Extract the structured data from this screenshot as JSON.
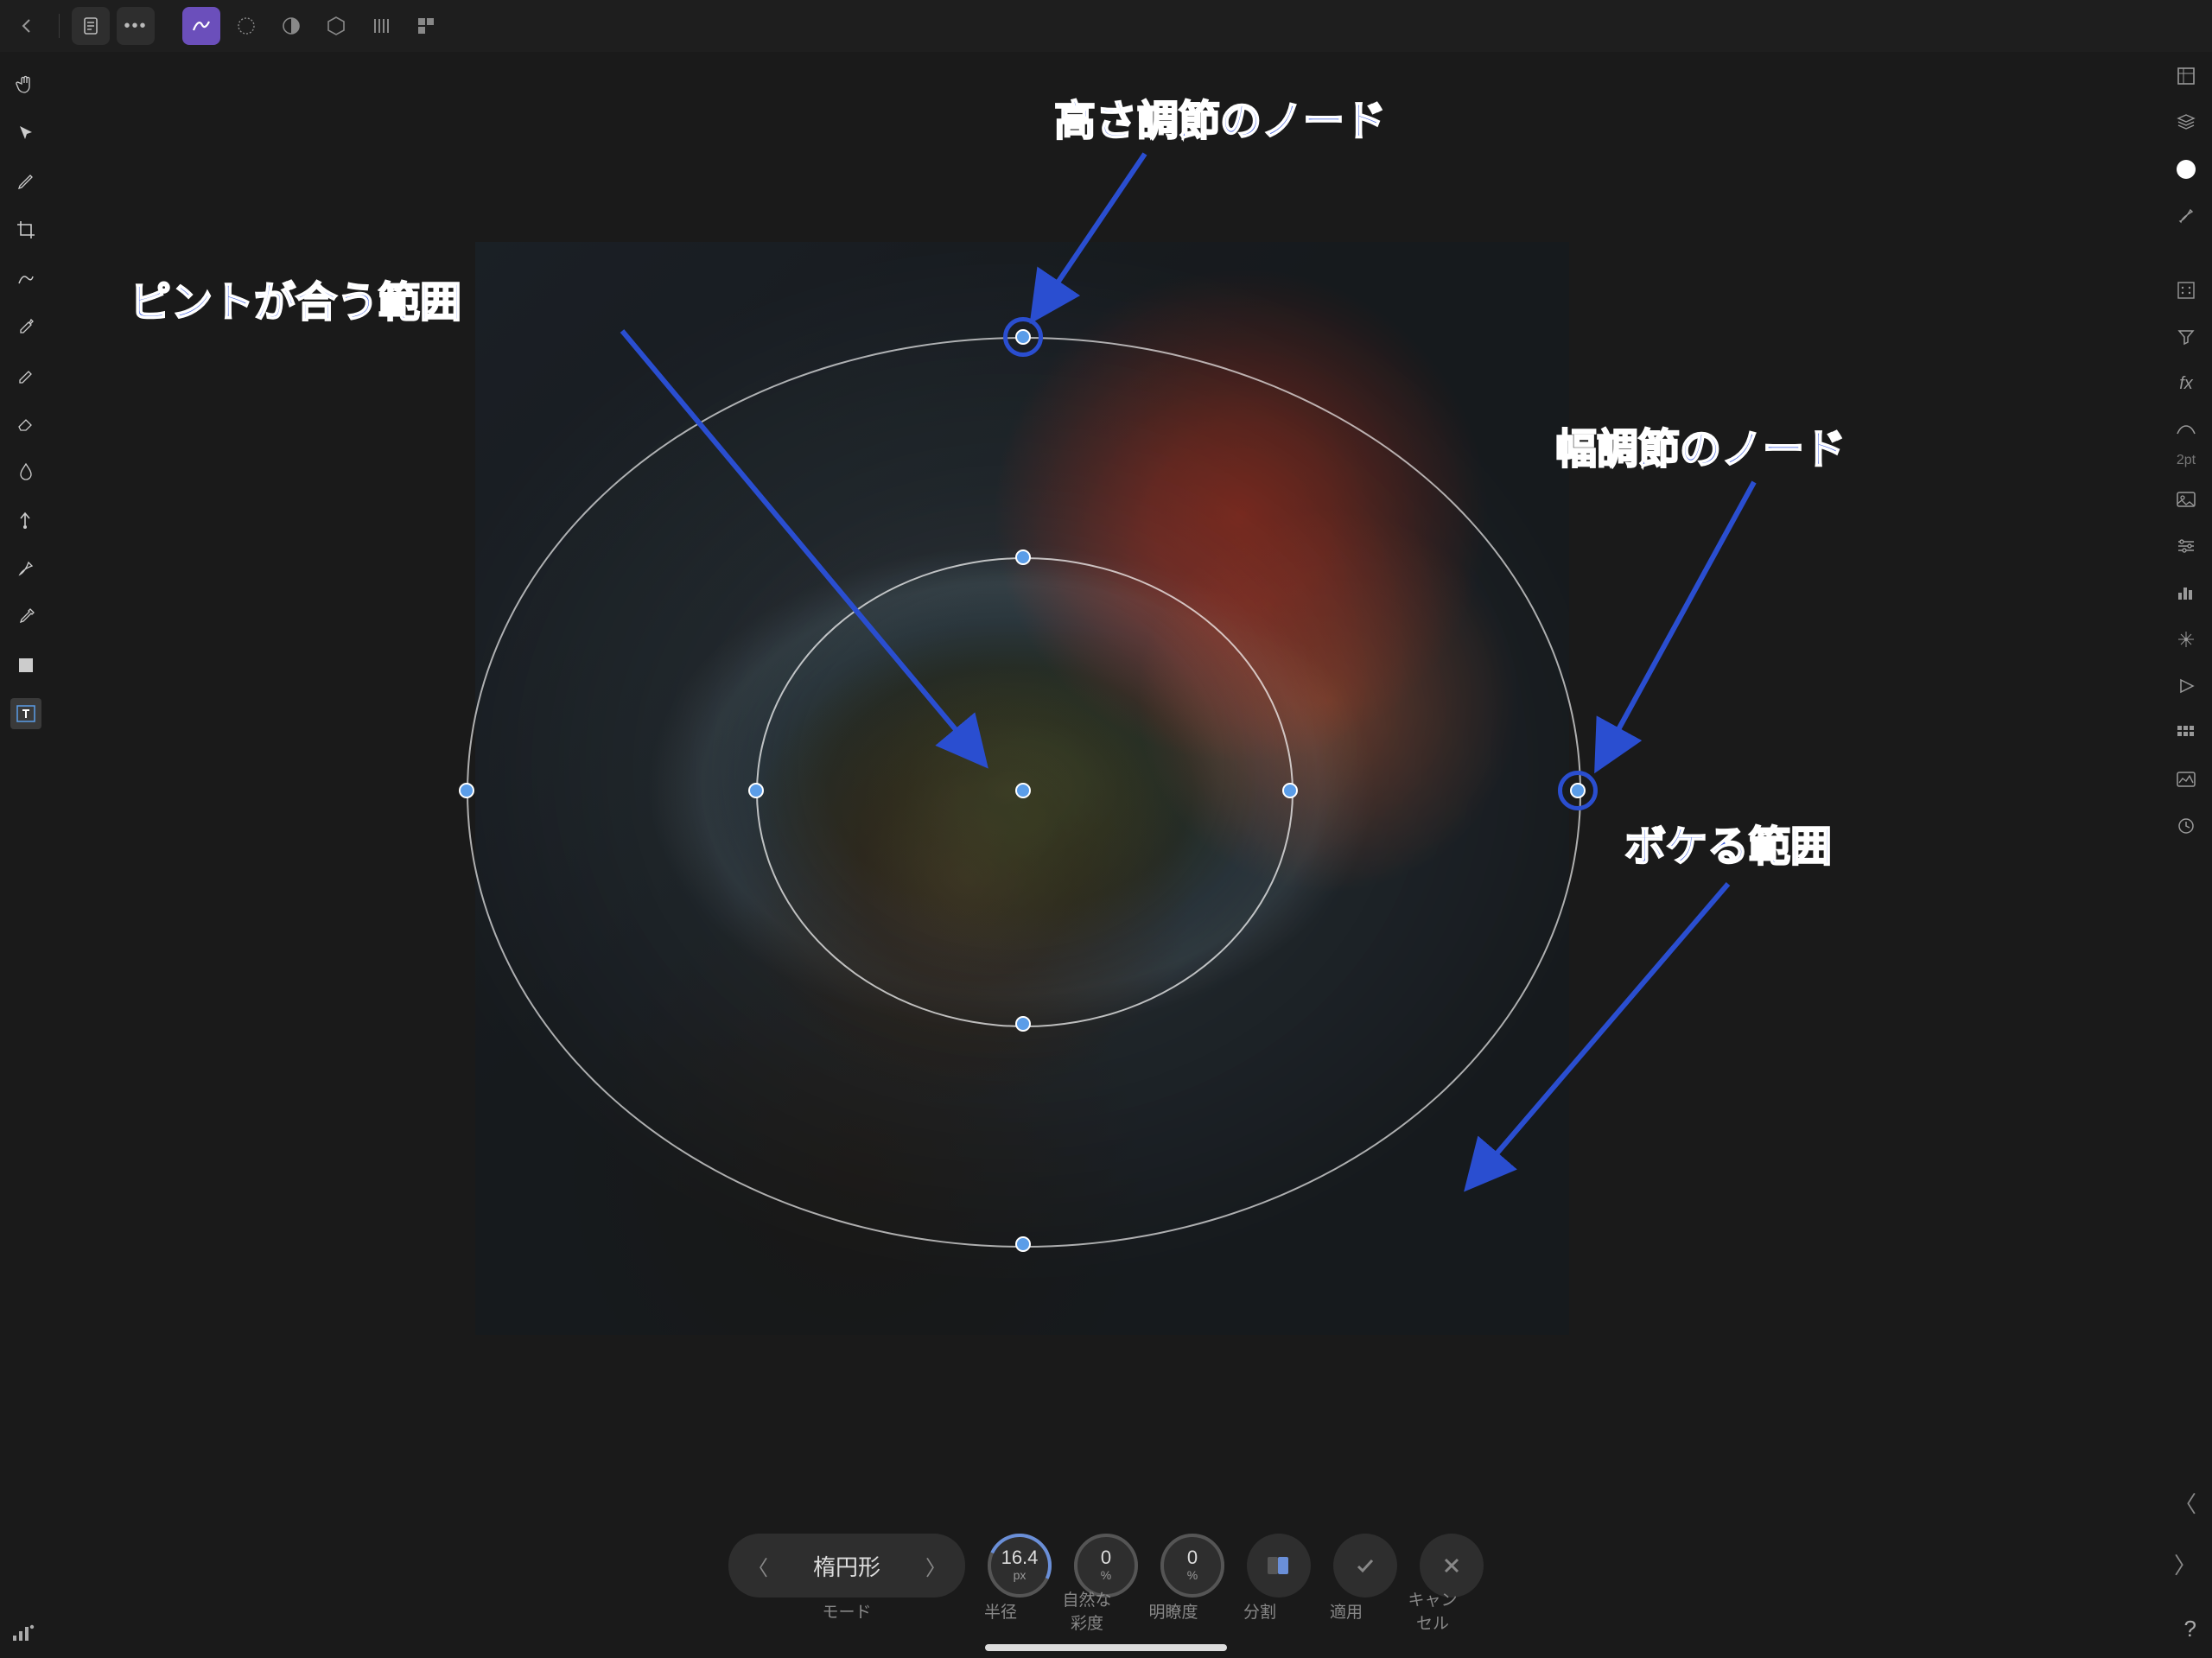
{
  "topbar": {
    "back": "←",
    "doc": "⎘",
    "more": "•••"
  },
  "annotations": {
    "height_node": "高さ調節のノード",
    "focus_range": "ピントが合う範囲",
    "width_node": "幅調節のノード",
    "blur_range": "ボケる範囲"
  },
  "bottom": {
    "mode_value": "楕円形",
    "mode_label": "モード",
    "radius_value": "16.4",
    "radius_unit": "px",
    "radius_label": "半径",
    "vibrance_value": "0",
    "vibrance_unit": "%",
    "vibrance_label": "自然な彩度",
    "clarity_value": "0",
    "clarity_unit": "%",
    "clarity_label": "明瞭度",
    "split_label": "分割",
    "apply_label": "適用",
    "cancel_label": "キャンセル"
  },
  "right_stroke": "2pt",
  "help": "?"
}
